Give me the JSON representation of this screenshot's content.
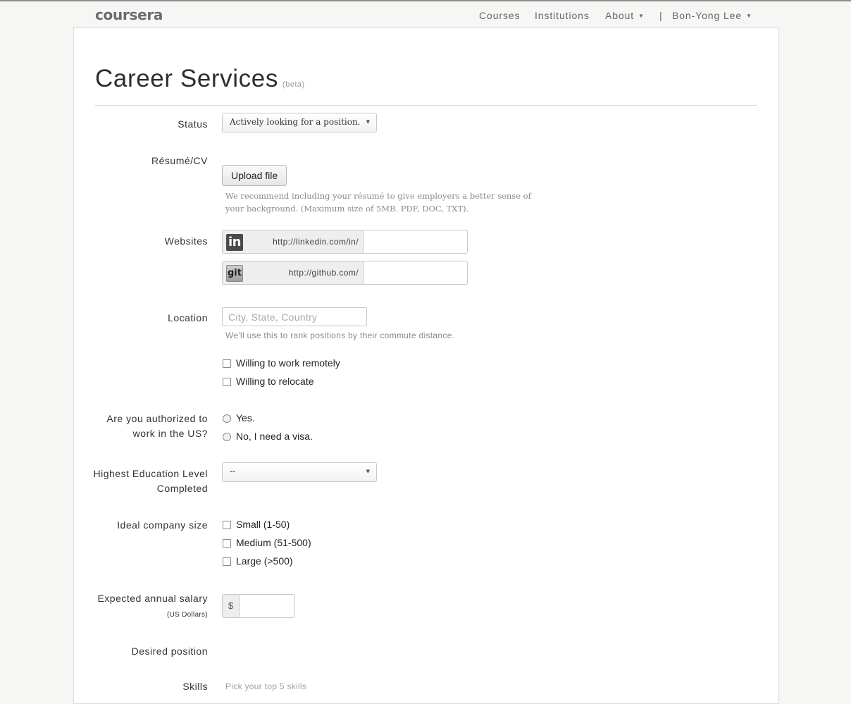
{
  "nav": {
    "logo": "coursera",
    "links": [
      "Courses",
      "Institutions",
      "About"
    ],
    "separator": "|",
    "user": "Bon-Yong Lee",
    "caret": "▼"
  },
  "page": {
    "title": "Career Services",
    "beta": "(beta)"
  },
  "form": {
    "status": {
      "label": "Status",
      "value": "Actively looking for a position."
    },
    "resume": {
      "label": "Résumé/CV",
      "button": "Upload file",
      "help": "We recommend including your résumé to give employers a better sense of your background. (Maximum size of 5MB. PDF, DOC, TXT)."
    },
    "websites": {
      "label": "Websites",
      "linkedin": {
        "icon": "in",
        "prefix": "http://linkedin.com/in/",
        "value": ""
      },
      "github": {
        "icon": "git",
        "prefix": "http://github.com/",
        "value": ""
      }
    },
    "location": {
      "label": "Location",
      "placeholder": "City, State, Country",
      "help": "We'll use this to rank positions by their commute distance.",
      "options": [
        "Willing to work remotely",
        "Willing to relocate"
      ]
    },
    "authorized": {
      "label_line1": "Are you authorized to",
      "label_line2": "work in the US?",
      "options": [
        "Yes.",
        "No, I need a visa."
      ]
    },
    "education": {
      "label_line1": "Highest Education Level",
      "label_line2": "Completed",
      "value": "--"
    },
    "company_size": {
      "label": "Ideal company size",
      "options": [
        "Small (1-50)",
        "Medium (51-500)",
        "Large (>500)"
      ]
    },
    "salary": {
      "label": "Expected annual salary",
      "sublabel": "(US Dollars)",
      "currency": "$",
      "value": ""
    },
    "desired_position": {
      "label": "Desired position"
    },
    "skills": {
      "label": "Skills",
      "help": "Pick your top 5 skills"
    }
  }
}
